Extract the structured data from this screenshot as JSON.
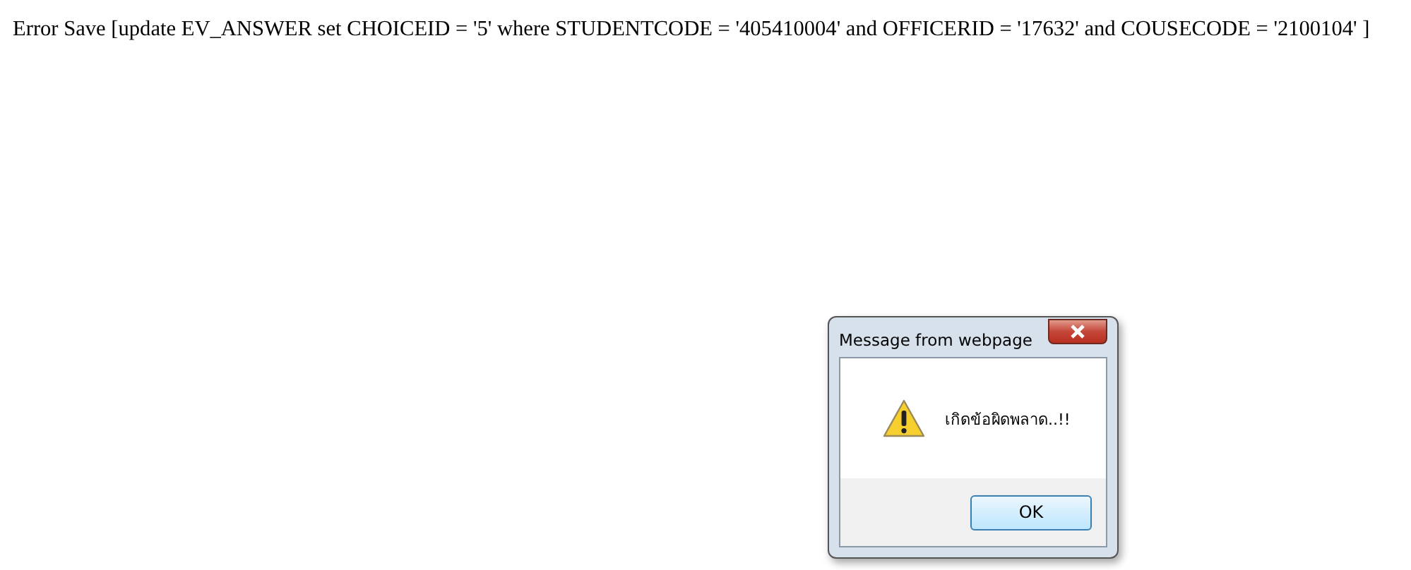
{
  "page": {
    "error_text": "Error Save [update EV_ANSWER set CHOICEID = '5' where STUDENTCODE = '405410004' and OFFICERID = '17632' and COUSECODE = '2100104' ]"
  },
  "dialog": {
    "title": "Message from webpage",
    "message": "เกิดข้อผิดพลาด..!!",
    "buttons": [
      "OK"
    ]
  }
}
